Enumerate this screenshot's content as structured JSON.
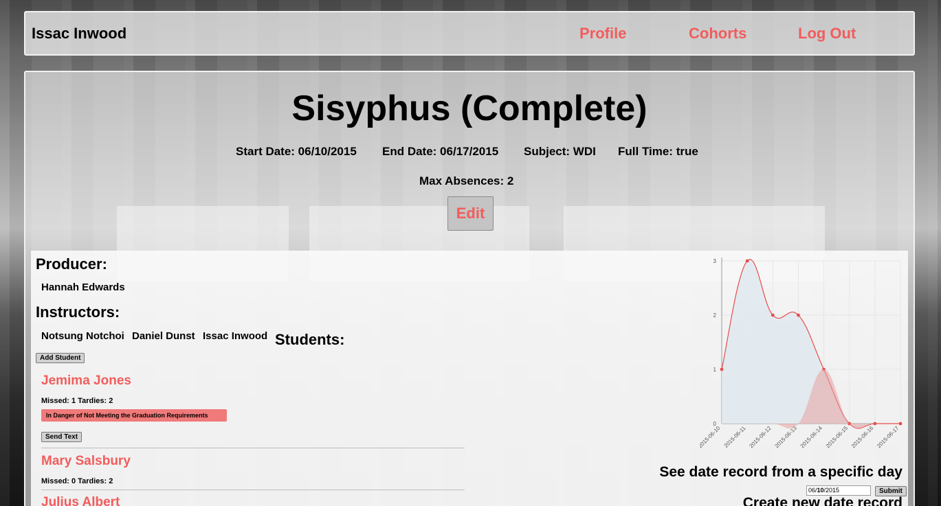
{
  "nav": {
    "brand": "Issac Inwood",
    "profile": "Profile",
    "cohorts": "Cohorts",
    "logout": "Log Out"
  },
  "cohort": {
    "title": "Sisyphus (Complete)",
    "start_date": "Start Date: 06/10/2015",
    "end_date": "End Date: 06/17/2015",
    "subject": "Subject: WDI",
    "full_time": "Full Time: true",
    "max_absences": "Max Absences: 2",
    "edit_label": "Edit"
  },
  "producer": {
    "heading": "Producer:",
    "name": "Hannah Edwards"
  },
  "instructors": {
    "heading": "Instructors:",
    "names": [
      "Notsung Notchoi",
      "Daniel Dunst",
      "Issac Inwood"
    ]
  },
  "students": {
    "heading": "Students:",
    "add_label": "Add Student",
    "list": [
      {
        "name": "Jemima Jones",
        "stats": "Missed: 1 Tardies: 2",
        "warning": "In Danger of Not Meeting the Graduation Requirements",
        "send_text": "Send Text"
      },
      {
        "name": "Mary Salsbury",
        "stats": "Missed: 0 Tardies: 2"
      },
      {
        "name": "Julius Albert"
      }
    ]
  },
  "date_record": {
    "heading": "See date record from a specific day",
    "date_month": "06/",
    "date_day": "10",
    "date_year": "/2015",
    "submit": "Submit",
    "create_heading": "Create new date record"
  },
  "colors": {
    "accent": "#f25c5c",
    "absence_line": "#e84c4c",
    "absence_fill": "#dfe9ef",
    "tardy_fill": "#e8a0a0"
  },
  "chart_data": {
    "type": "line",
    "x": [
      "2015-06-10",
      "2015-06-11",
      "2015-06-12",
      "2015-06-13",
      "2015-06-14",
      "2015-06-15",
      "2015-06-16",
      "2015-06-17"
    ],
    "yticks": [
      "0",
      "1",
      "2",
      "3"
    ],
    "ylim": [
      0,
      3
    ],
    "series": [
      {
        "values": [
          1,
          3,
          2,
          2,
          1,
          0,
          0,
          0
        ],
        "style": "line-area",
        "color": "#e84c4c"
      },
      {
        "values": [
          0,
          0,
          0,
          0,
          1,
          0,
          0,
          0
        ],
        "style": "area",
        "color": "#e8a0a0"
      }
    ],
    "grid": true
  }
}
